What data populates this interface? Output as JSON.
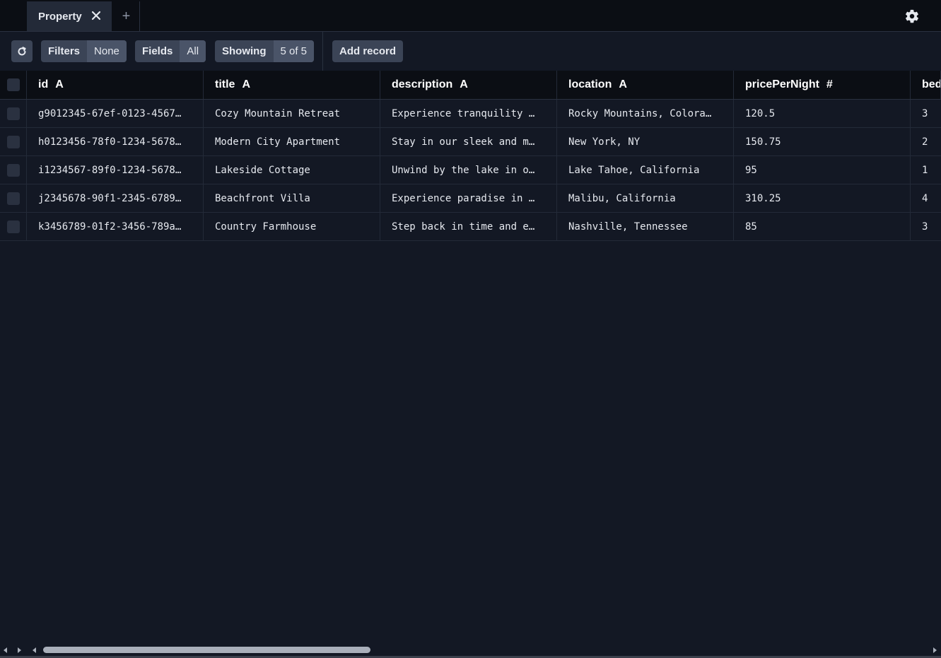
{
  "tabs": [
    {
      "label": "Property",
      "close_icon": "close-icon"
    }
  ],
  "add_tab_label": "+",
  "toolbar": {
    "refresh_icon": "refresh-icon",
    "filters": {
      "label": "Filters",
      "value": "None"
    },
    "fields": {
      "label": "Fields",
      "value": "All"
    },
    "showing": {
      "label": "Showing",
      "value": "5 of 5"
    },
    "add_record_label": "Add record"
  },
  "table": {
    "columns": [
      {
        "name": "id",
        "type": "A"
      },
      {
        "name": "title",
        "type": "A"
      },
      {
        "name": "description",
        "type": "A"
      },
      {
        "name": "location",
        "type": "A"
      },
      {
        "name": "pricePerNight",
        "type": "#"
      },
      {
        "name": "bed",
        "type": ""
      }
    ],
    "rows": [
      [
        "g9012345-67ef-0123-4567…",
        "Cozy Mountain Retreat",
        "Experience tranquility …",
        "Rocky Mountains, Colora…",
        "120.5",
        "3"
      ],
      [
        "h0123456-78f0-1234-5678…",
        "Modern City Apartment",
        "Stay in our sleek and m…",
        "New York, NY",
        "150.75",
        "2"
      ],
      [
        "i1234567-89f0-1234-5678…",
        "Lakeside Cottage",
        "Unwind by the lake in o…",
        "Lake Tahoe, California",
        "95",
        "1"
      ],
      [
        "j2345678-90f1-2345-6789…",
        "Beachfront Villa",
        "Experience paradise in …",
        "Malibu, California",
        "310.25",
        "4"
      ],
      [
        "k3456789-01f2-3456-789a…",
        "Country Farmhouse",
        "Step back in time and e…",
        "Nashville, Tennessee",
        "85",
        "3"
      ]
    ]
  },
  "colors": {
    "background": "#131824",
    "header_background": "#0b0e14",
    "button": "#3b4456",
    "button_value": "#4a5468"
  }
}
